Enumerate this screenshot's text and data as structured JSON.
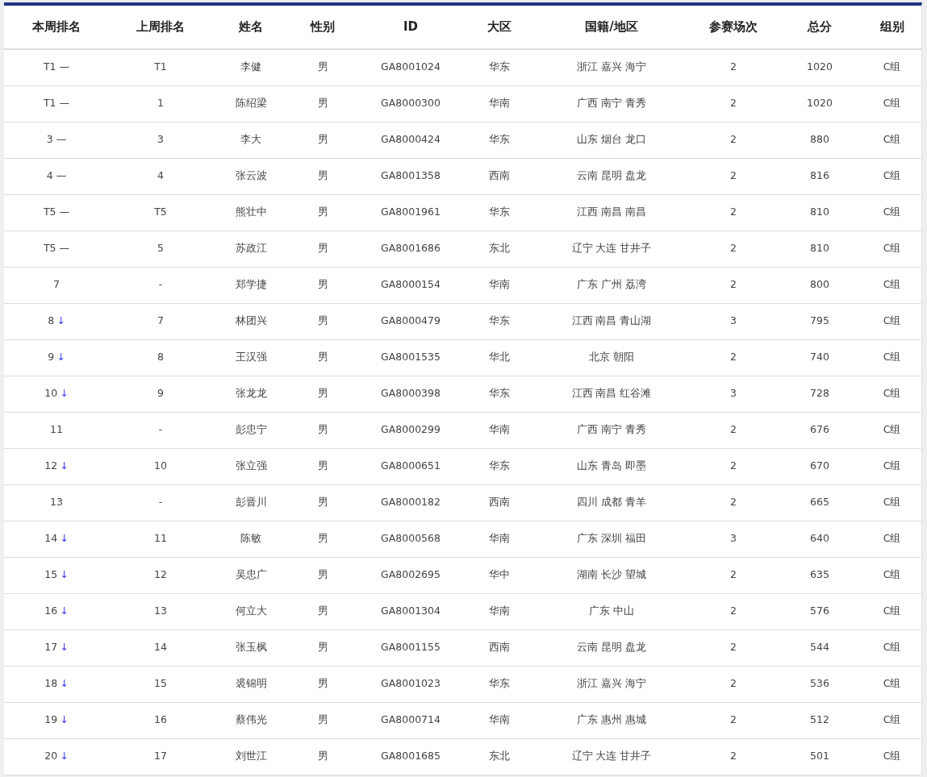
{
  "table": {
    "columns": [
      "本周排名",
      "上周排名",
      "姓名",
      "性别",
      "ID",
      "大区",
      "国籍/地区",
      "参赛场次",
      "总分",
      "组别"
    ],
    "rows": [
      {
        "cells": [
          "T1",
          "T1",
          "李健",
          "男",
          "GA8001024",
          "华东",
          "浙江 嘉兴 海宁",
          "2",
          "1020",
          "C组"
        ],
        "trend": {
          "mark": "—",
          "kind": "same"
        }
      },
      {
        "cells": [
          "T1",
          "1",
          "陈绍梁",
          "男",
          "GA8000300",
          "华南",
          "广西 南宁 青秀",
          "2",
          "1020",
          "C组"
        ],
        "trend": {
          "mark": "—",
          "kind": "same"
        }
      },
      {
        "cells": [
          "3",
          "3",
          "李大",
          "男",
          "GA8000424",
          "华东",
          "山东 烟台 龙口",
          "2",
          "880",
          "C组"
        ],
        "trend": {
          "mark": "—",
          "kind": "same"
        }
      },
      {
        "cells": [
          "4",
          "4",
          "张云波",
          "男",
          "GA8001358",
          "西南",
          "云南 昆明 盘龙",
          "2",
          "816",
          "C组"
        ],
        "trend": {
          "mark": "—",
          "kind": "same"
        }
      },
      {
        "cells": [
          "T5",
          "T5",
          "熊壮中",
          "男",
          "GA8001961",
          "华东",
          "江西 南昌 南昌",
          "2",
          "810",
          "C组"
        ],
        "trend": {
          "mark": "—",
          "kind": "same"
        }
      },
      {
        "cells": [
          "T5",
          "5",
          "苏政江",
          "男",
          "GA8001686",
          "东北",
          "辽宁 大连 甘井子",
          "2",
          "810",
          "C组"
        ],
        "trend": {
          "mark": "—",
          "kind": "same"
        }
      },
      {
        "cells": [
          "7",
          "-",
          "郑学捷",
          "男",
          "GA8000154",
          "华南",
          "广东 广州 荔湾",
          "2",
          "800",
          "C组"
        ]
      },
      {
        "cells": [
          "8",
          "7",
          "林团兴",
          "男",
          "GA8000479",
          "华东",
          "江西 南昌 青山湖",
          "3",
          "795",
          "C组"
        ],
        "trend": {
          "mark": "↓",
          "kind": "down"
        }
      },
      {
        "cells": [
          "9",
          "8",
          "王汉强",
          "男",
          "GA8001535",
          "华北",
          "北京 朝阳",
          "2",
          "740",
          "C组"
        ],
        "trend": {
          "mark": "↓",
          "kind": "down"
        }
      },
      {
        "cells": [
          "10",
          "9",
          "张龙龙",
          "男",
          "GA8000398",
          "华东",
          "江西 南昌 红谷滩",
          "3",
          "728",
          "C组"
        ],
        "trend": {
          "mark": "↓",
          "kind": "down"
        }
      },
      {
        "cells": [
          "11",
          "-",
          "彭忠宁",
          "男",
          "GA8000299",
          "华南",
          "广西 南宁 青秀",
          "2",
          "676",
          "C组"
        ]
      },
      {
        "cells": [
          "12",
          "10",
          "张立强",
          "男",
          "GA8000651",
          "华东",
          "山东 青岛 即墨",
          "2",
          "670",
          "C组"
        ],
        "trend": {
          "mark": "↓",
          "kind": "down"
        }
      },
      {
        "cells": [
          "13",
          "-",
          "彭晋川",
          "男",
          "GA8000182",
          "西南",
          "四川 成都 青羊",
          "2",
          "665",
          "C组"
        ]
      },
      {
        "cells": [
          "14",
          "11",
          "陈敏",
          "男",
          "GA8000568",
          "华南",
          "广东 深圳 福田",
          "3",
          "640",
          "C组"
        ],
        "trend": {
          "mark": "↓",
          "kind": "down"
        }
      },
      {
        "cells": [
          "15",
          "12",
          "吴忠广",
          "男",
          "GA8002695",
          "华中",
          "湖南 长沙 望城",
          "2",
          "635",
          "C组"
        ],
        "trend": {
          "mark": "↓",
          "kind": "down"
        }
      },
      {
        "cells": [
          "16",
          "13",
          "何立大",
          "男",
          "GA8001304",
          "华南",
          "广东 中山",
          "2",
          "576",
          "C组"
        ],
        "trend": {
          "mark": "↓",
          "kind": "down"
        }
      },
      {
        "cells": [
          "17",
          "14",
          "张玉枫",
          "男",
          "GA8001155",
          "西南",
          "云南 昆明 盘龙",
          "2",
          "544",
          "C组"
        ],
        "trend": {
          "mark": "↓",
          "kind": "down"
        }
      },
      {
        "cells": [
          "18",
          "15",
          "裘锦明",
          "男",
          "GA8001023",
          "华东",
          "浙江 嘉兴 海宁",
          "2",
          "536",
          "C组"
        ],
        "trend": {
          "mark": "↓",
          "kind": "down"
        }
      },
      {
        "cells": [
          "19",
          "16",
          "蔡伟光",
          "男",
          "GA8000714",
          "华南",
          "广东 惠州 惠城",
          "2",
          "512",
          "C组"
        ],
        "trend": {
          "mark": "↓",
          "kind": "down"
        }
      },
      {
        "cells": [
          "20",
          "17",
          "刘世江",
          "男",
          "GA8001685",
          "东北",
          "辽宁 大连 甘井子",
          "2",
          "501",
          "C组"
        ],
        "trend": {
          "mark": "↓",
          "kind": "down"
        }
      }
    ]
  }
}
